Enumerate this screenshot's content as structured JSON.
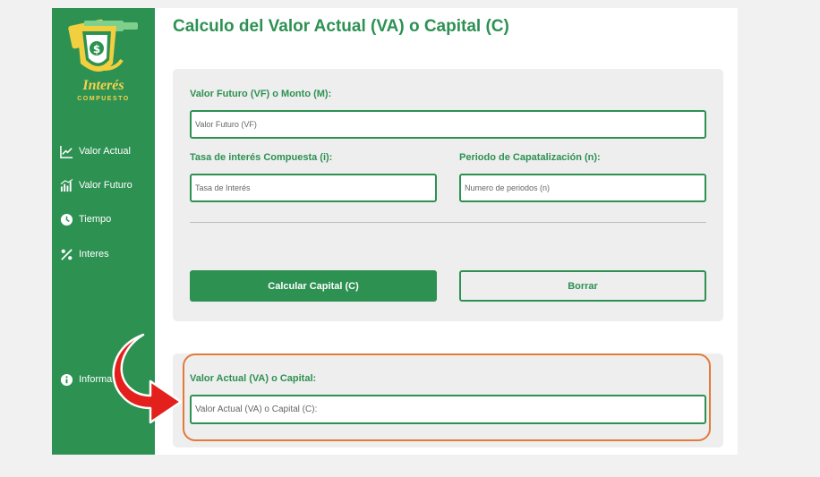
{
  "sidebar": {
    "logo": {
      "title": "Interés",
      "subtitle": "COMPUESTO"
    },
    "items": [
      {
        "label": "Valor Actual",
        "icon": "line-chart-icon"
      },
      {
        "label": "Valor Futuro",
        "icon": "bar-chart-icon"
      },
      {
        "label": "Tiempo",
        "icon": "clock-icon"
      },
      {
        "label": "Interes",
        "icon": "percent-icon"
      }
    ],
    "info": {
      "label": "Informa",
      "icon": "info-icon"
    }
  },
  "main": {
    "title": "Calculo del Valor Actual (VA) o Capital (C)",
    "form": {
      "vf_label": "Valor Futuro (VF) o Monto (M):",
      "vf_placeholder": "Valor Futuro (VF)",
      "rate_label": "Tasa de interés Compuesta (i):",
      "rate_placeholder": "Tasa de Interés",
      "periods_label": "Periodo de Capatalización (n):",
      "periods_placeholder": "Numero de periodos (n)",
      "calc_button": "Calcular Capital (C)",
      "clear_button": "Borrar"
    },
    "result": {
      "label": "Valor Actual (VA) o Capital:",
      "placeholder": "Valor Actual (VA) o Capital (C):"
    }
  },
  "colors": {
    "brand_green": "#2d9152",
    "logo_yellow": "#f7d24a",
    "card_bg": "#eeeeee",
    "highlight_orange": "#e27b3a",
    "arrow_red": "#e3201b"
  }
}
